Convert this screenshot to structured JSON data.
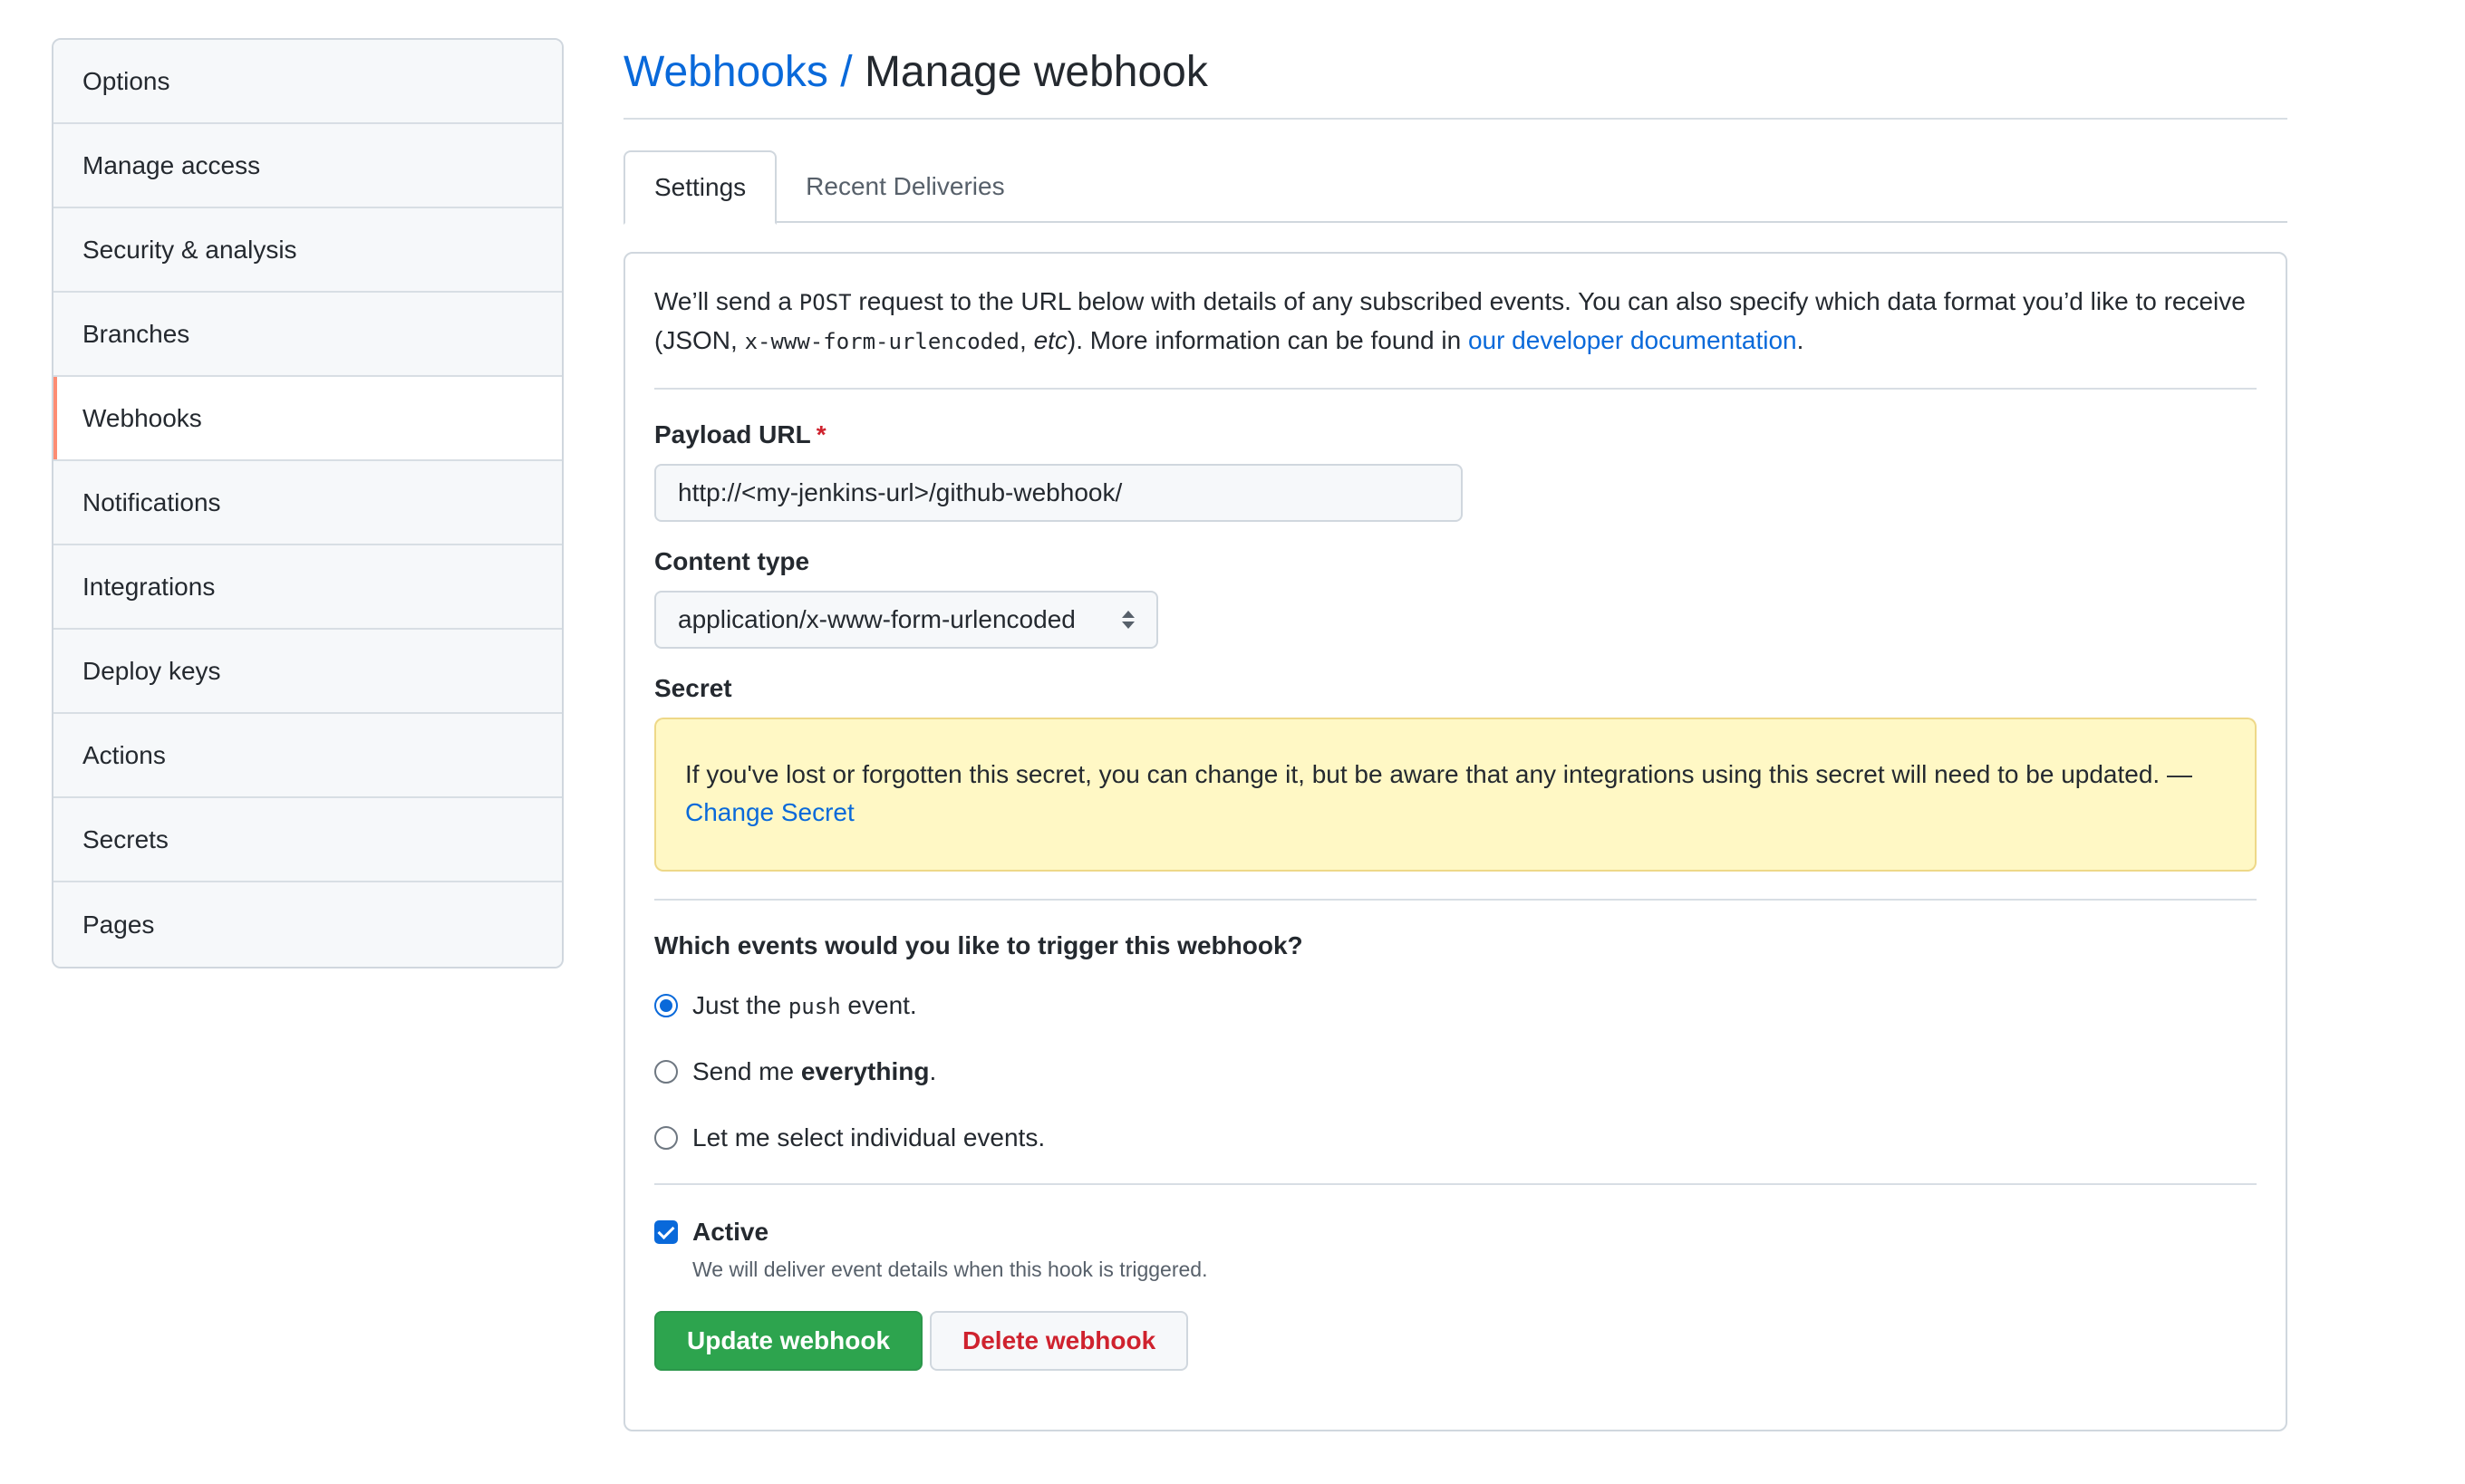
{
  "sidebar": {
    "items": [
      {
        "label": "Options"
      },
      {
        "label": "Manage access"
      },
      {
        "label": "Security & analysis"
      },
      {
        "label": "Branches"
      },
      {
        "label": "Webhooks",
        "selected": true
      },
      {
        "label": "Notifications"
      },
      {
        "label": "Integrations"
      },
      {
        "label": "Deploy keys"
      },
      {
        "label": "Actions"
      },
      {
        "label": "Secrets"
      },
      {
        "label": "Pages"
      }
    ]
  },
  "header": {
    "crumb_link": "Webhooks",
    "crumb_sep": " / ",
    "title": "Manage webhook"
  },
  "tabs": [
    {
      "label": "Settings",
      "active": true
    },
    {
      "label": "Recent Deliveries"
    }
  ],
  "intro": {
    "p1": "We’ll send a ",
    "code1": "POST",
    "p2": " request to the URL below with details of any subscribed events. You can also specify which data format you’d like to receive (JSON, ",
    "code2": "x-www-form-urlencoded",
    "p3": ", ",
    "em": "etc",
    "p4": "). More information can be found in ",
    "link": "our developer documentation",
    "p5": "."
  },
  "payload": {
    "label": "Payload URL",
    "required_mark": "*",
    "value": "http://<my-jenkins-url>/github-webhook/"
  },
  "content_type": {
    "label": "Content type",
    "selected": "application/x-www-form-urlencoded"
  },
  "secret": {
    "label": "Secret",
    "notice": "If you've lost or forgotten this secret, you can change it, but be aware that any integrations using this secret will need to be updated. — ",
    "link": "Change Secret"
  },
  "events": {
    "question": "Which events would you like to trigger this webhook?",
    "options": [
      {
        "pre": "Just the ",
        "code": "push",
        "post": " event.",
        "checked": true
      },
      {
        "pre": "Send me ",
        "bold": "everything",
        "post": ".",
        "checked": false
      },
      {
        "text": "Let me select individual events.",
        "checked": false
      }
    ]
  },
  "active": {
    "label": "Active",
    "help": "We will deliver event details when this hook is triggered.",
    "checked": true
  },
  "buttons": {
    "update": "Update webhook",
    "delete": "Delete webhook"
  },
  "colors": {
    "link": "#0969da",
    "primary": "#2da44e",
    "danger": "#cf222e",
    "selected_marker": "#fd8c73",
    "notice_bg": "#fff8c5"
  }
}
